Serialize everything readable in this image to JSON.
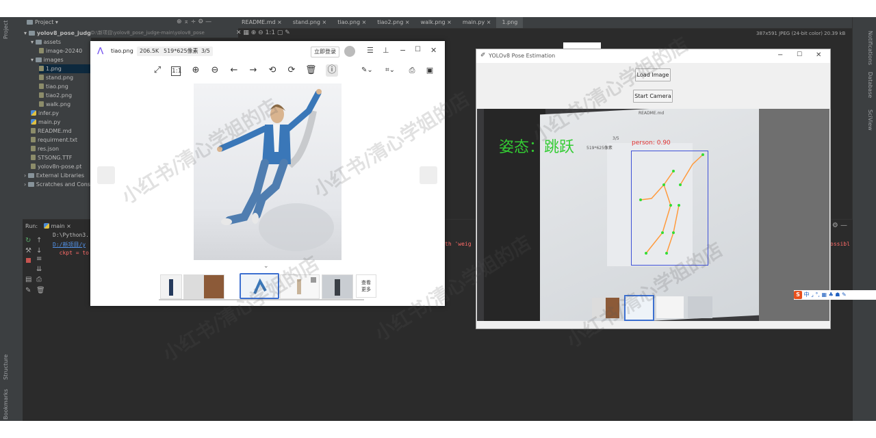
{
  "ide": {
    "side_labels": {
      "project": "Project",
      "structure": "Structure",
      "bookmarks": "Bookmarks"
    },
    "right_labels": {
      "notifications": "Notifications",
      "database": "Database",
      "sciview": "SciView"
    },
    "project_header": "Project",
    "project_root": "yolov8_pose_judge-main",
    "project_root_path": "D:\\新项目\\yolov8_pose_judge-main\\yolov8_pose",
    "tree": [
      {
        "label": "assets",
        "kind": "folder",
        "indent": 0
      },
      {
        "label": "image-20240",
        "kind": "file",
        "indent": 1
      },
      {
        "label": "images",
        "kind": "folder",
        "indent": 0
      },
      {
        "label": "1.png",
        "kind": "file",
        "indent": 1,
        "selected": true
      },
      {
        "label": "stand.png",
        "kind": "file",
        "indent": 1
      },
      {
        "label": "tiao.png",
        "kind": "file",
        "indent": 1
      },
      {
        "label": "tiao2.png",
        "kind": "file",
        "indent": 1
      },
      {
        "label": "walk.png",
        "kind": "file",
        "indent": 1
      },
      {
        "label": "infer.py",
        "kind": "py",
        "indent": 0
      },
      {
        "label": "main.py",
        "kind": "py",
        "indent": 0
      },
      {
        "label": "README.md",
        "kind": "file",
        "indent": 0
      },
      {
        "label": "requirment.txt",
        "kind": "file",
        "indent": 0
      },
      {
        "label": "res.json",
        "kind": "file",
        "indent": 0
      },
      {
        "label": "STSONG.TTF",
        "kind": "file",
        "indent": 0
      },
      {
        "label": "yolov8n-pose.pt",
        "kind": "file",
        "indent": 0
      },
      {
        "label": "External Libraries",
        "kind": "lib",
        "indent": -1
      },
      {
        "label": "Scratches and Cons",
        "kind": "lib",
        "indent": -1
      }
    ],
    "tabs": [
      {
        "label": "README.md"
      },
      {
        "label": "stand.png"
      },
      {
        "label": "tiao.png"
      },
      {
        "label": "tiao2.png"
      },
      {
        "label": "walk.png"
      },
      {
        "label": "main.py"
      },
      {
        "label": "1.png",
        "active": true
      }
    ],
    "image_info": "387x591 JPEG (24-bit color) 20.39 kB",
    "editor_zoom_label": "1:1",
    "run": {
      "label": "Run:",
      "config": "main",
      "lines": [
        "D:\\Python3.",
        "D:/新项目/y",
        "  ckpt = to"
      ],
      "right_frag1": "th 'weig",
      "right_frag2": "ossibl"
    }
  },
  "viewer": {
    "filename": "tiao.png",
    "size": "206.5K",
    "dims": "519*625像素",
    "index": "3/5",
    "login": "立即登录",
    "more": "查看\n更多",
    "expand": "⌄"
  },
  "yolo": {
    "title": "YOLOv8 Pose Estimation",
    "load_button": "Load Image",
    "camera_button": "Start Camera",
    "pose_label": "姿态：跳跃",
    "person_label": "person: 0.90",
    "mini_tab": "README.md",
    "mini_label": "519*625像素",
    "mini_index": "3/5"
  },
  "ime": {
    "text": "中 ⌟ °, ▦ ♣ ☗ ✎"
  },
  "watermark": "小红书/清心学姐的店"
}
